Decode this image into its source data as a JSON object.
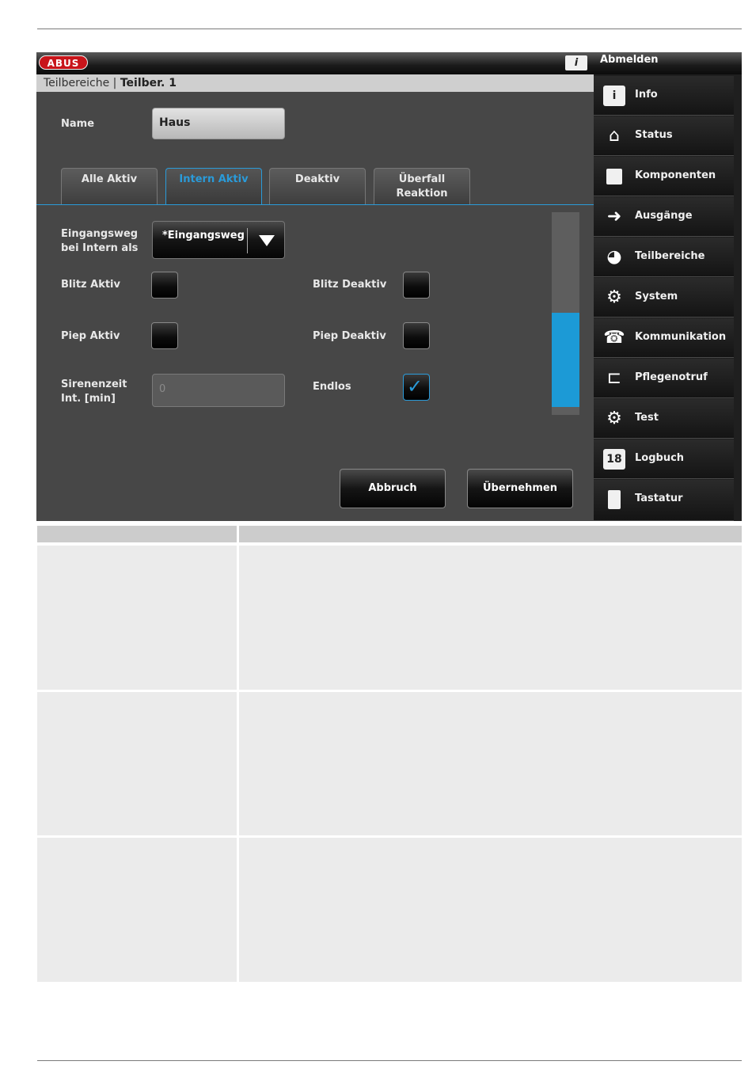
{
  "app": {
    "logo_text": "ABUS",
    "info_icon": "info-user-icon",
    "breadcrumb": {
      "section": "Teilbereiche",
      "separator": "|",
      "current": "Teilber. 1"
    },
    "logout_label": "Abmelden"
  },
  "form": {
    "name_label": "Name",
    "name_value": "Haus",
    "tabs": [
      {
        "label": "Alle Aktiv"
      },
      {
        "label": "Intern Aktiv"
      },
      {
        "label": "Deaktiv"
      },
      {
        "label": "Überfall Reaktion"
      }
    ],
    "entry_label": "Eingangsweg bei Intern als",
    "entry_value": "*Eingangsweg",
    "flash_on_label": "Blitz Aktiv",
    "flash_off_label": "Blitz Deaktiv",
    "beep_on_label": "Piep Aktiv",
    "beep_off_label": "Piep Deaktiv",
    "siren_label": "Sirenenzeit Int. [min]",
    "siren_placeholder": "0",
    "endless_label": "Endlos",
    "cancel_label": "Abbruch",
    "apply_label": "Übernehmen"
  },
  "sidebar": {
    "items": [
      {
        "label": "Info",
        "icon": "info-icon"
      },
      {
        "label": "Status",
        "icon": "home-icon"
      },
      {
        "label": "Komponenten",
        "icon": "square-icon"
      },
      {
        "label": "Ausgänge",
        "icon": "exit-icon"
      },
      {
        "label": "Teilbereiche",
        "icon": "sectors-icon"
      },
      {
        "label": "System",
        "icon": "gear-icon"
      },
      {
        "label": "Kommunikation",
        "icon": "phone-icon"
      },
      {
        "label": "Pflegenotruf",
        "icon": "bed-icon"
      },
      {
        "label": "Test",
        "icon": "gear-icon"
      },
      {
        "label": "Logbuch",
        "icon": "calendar-icon"
      },
      {
        "label": "Tastatur",
        "icon": "keypad-icon"
      }
    ],
    "calendar_day": "18"
  }
}
